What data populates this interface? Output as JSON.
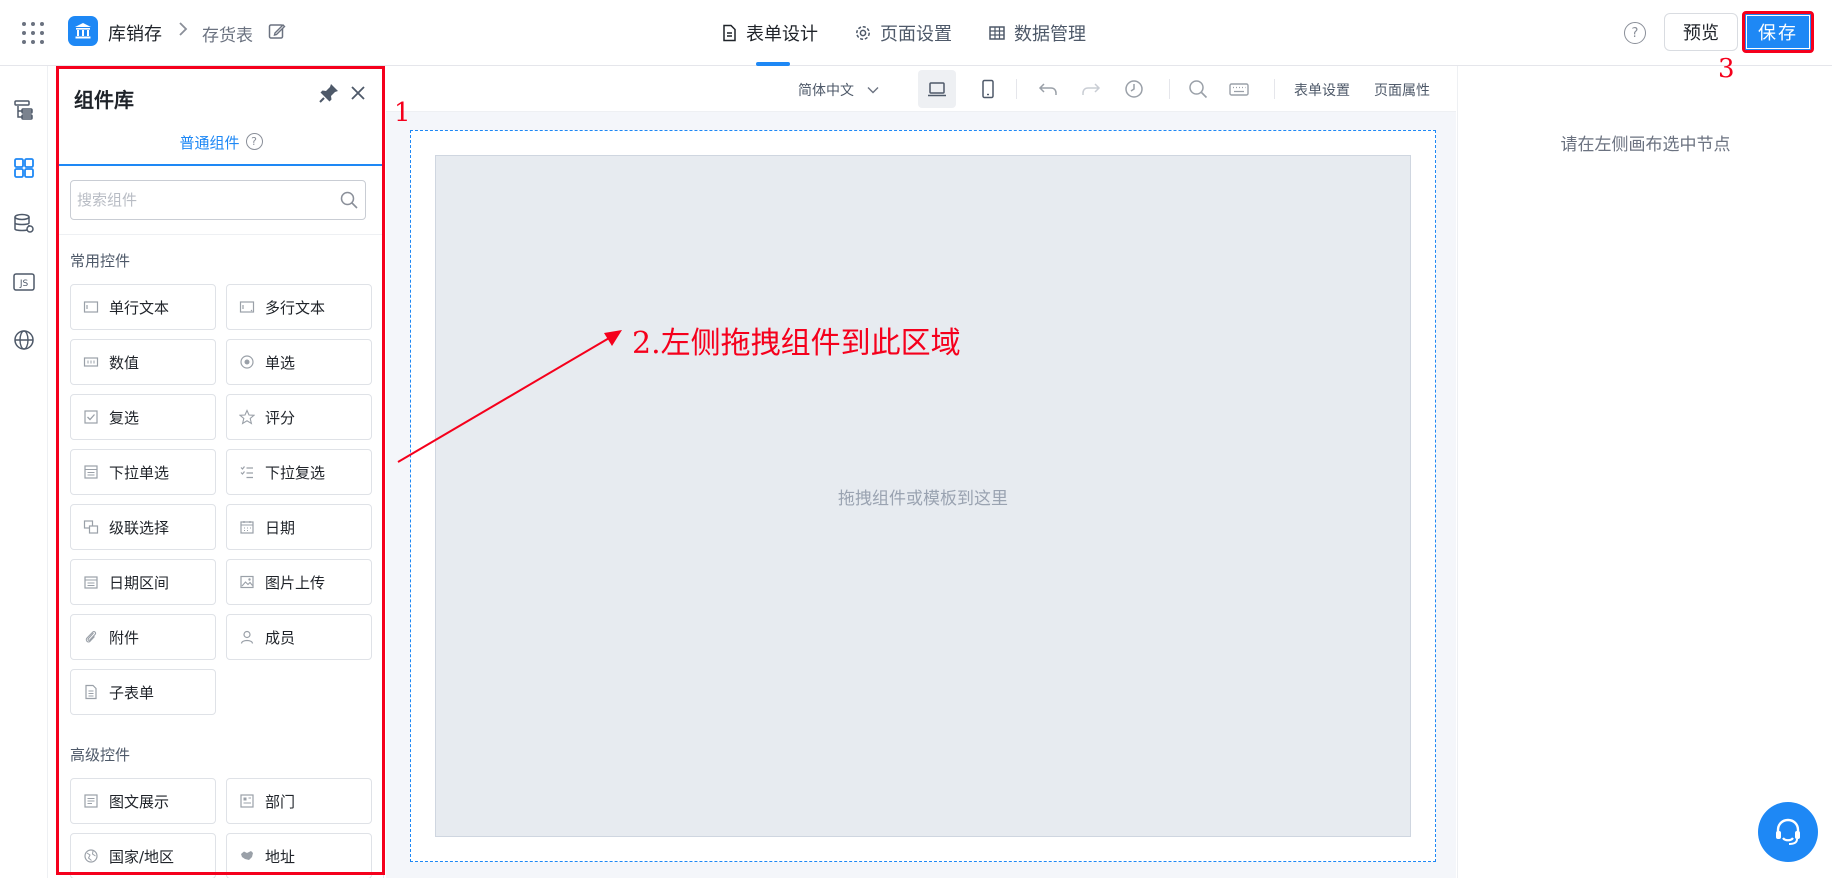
{
  "header": {
    "app_name": "库销存",
    "breadcrumb_separator": ">",
    "page_name": "存货表",
    "tabs": [
      {
        "label": "表单设计",
        "active": true,
        "icon": "document-icon"
      },
      {
        "label": "页面设置",
        "active": false,
        "icon": "gear-icon"
      },
      {
        "label": "数据管理",
        "active": false,
        "icon": "table-icon"
      }
    ],
    "help_label": "?",
    "preview_label": "预览",
    "save_label": "保存"
  },
  "rail": {
    "items": [
      "outline-icon",
      "components-icon",
      "datasource-icon",
      "js-icon",
      "globe-icon"
    ]
  },
  "panel": {
    "title": "组件库",
    "tab_label": "普通组件",
    "tab_help": "?",
    "search_placeholder": "搜索组件",
    "groups": [
      {
        "title": "常用控件",
        "items": [
          {
            "label": "单行文本",
            "icon": "single-line-icon"
          },
          {
            "label": "多行文本",
            "icon": "multi-line-icon"
          },
          {
            "label": "数值",
            "icon": "number-icon"
          },
          {
            "label": "单选",
            "icon": "radio-icon"
          },
          {
            "label": "复选",
            "icon": "checkbox-icon"
          },
          {
            "label": "评分",
            "icon": "star-icon"
          },
          {
            "label": "下拉单选",
            "icon": "dropdown-icon"
          },
          {
            "label": "下拉复选",
            "icon": "multi-dropdown-icon"
          },
          {
            "label": "级联选择",
            "icon": "cascade-icon"
          },
          {
            "label": "日期",
            "icon": "calendar-icon"
          },
          {
            "label": "日期区间",
            "icon": "date-range-icon"
          },
          {
            "label": "图片上传",
            "icon": "image-icon"
          },
          {
            "label": "附件",
            "icon": "attachment-icon"
          },
          {
            "label": "成员",
            "icon": "user-icon"
          },
          {
            "label": "子表单",
            "icon": "subform-icon"
          }
        ]
      },
      {
        "title": "高级控件",
        "items": [
          {
            "label": "图文展示",
            "icon": "rich-text-icon"
          },
          {
            "label": "部门",
            "icon": "department-icon"
          },
          {
            "label": "国家/地区",
            "icon": "globe-icon"
          },
          {
            "label": "地址",
            "icon": "map-icon"
          }
        ]
      }
    ]
  },
  "toolbar": {
    "language": "简体中文",
    "form_settings": "表单设置",
    "page_props": "页面属性"
  },
  "canvas": {
    "hint": "拖拽组件或模板到这里"
  },
  "right_panel": {
    "hint": "请在左侧画布选中节点"
  },
  "annotations": {
    "step1": "1",
    "step2": "2.左侧拖拽组件到此区域",
    "step3": "3"
  },
  "colors": {
    "accent": "#1e88f5",
    "annotation": "#f5001c"
  }
}
